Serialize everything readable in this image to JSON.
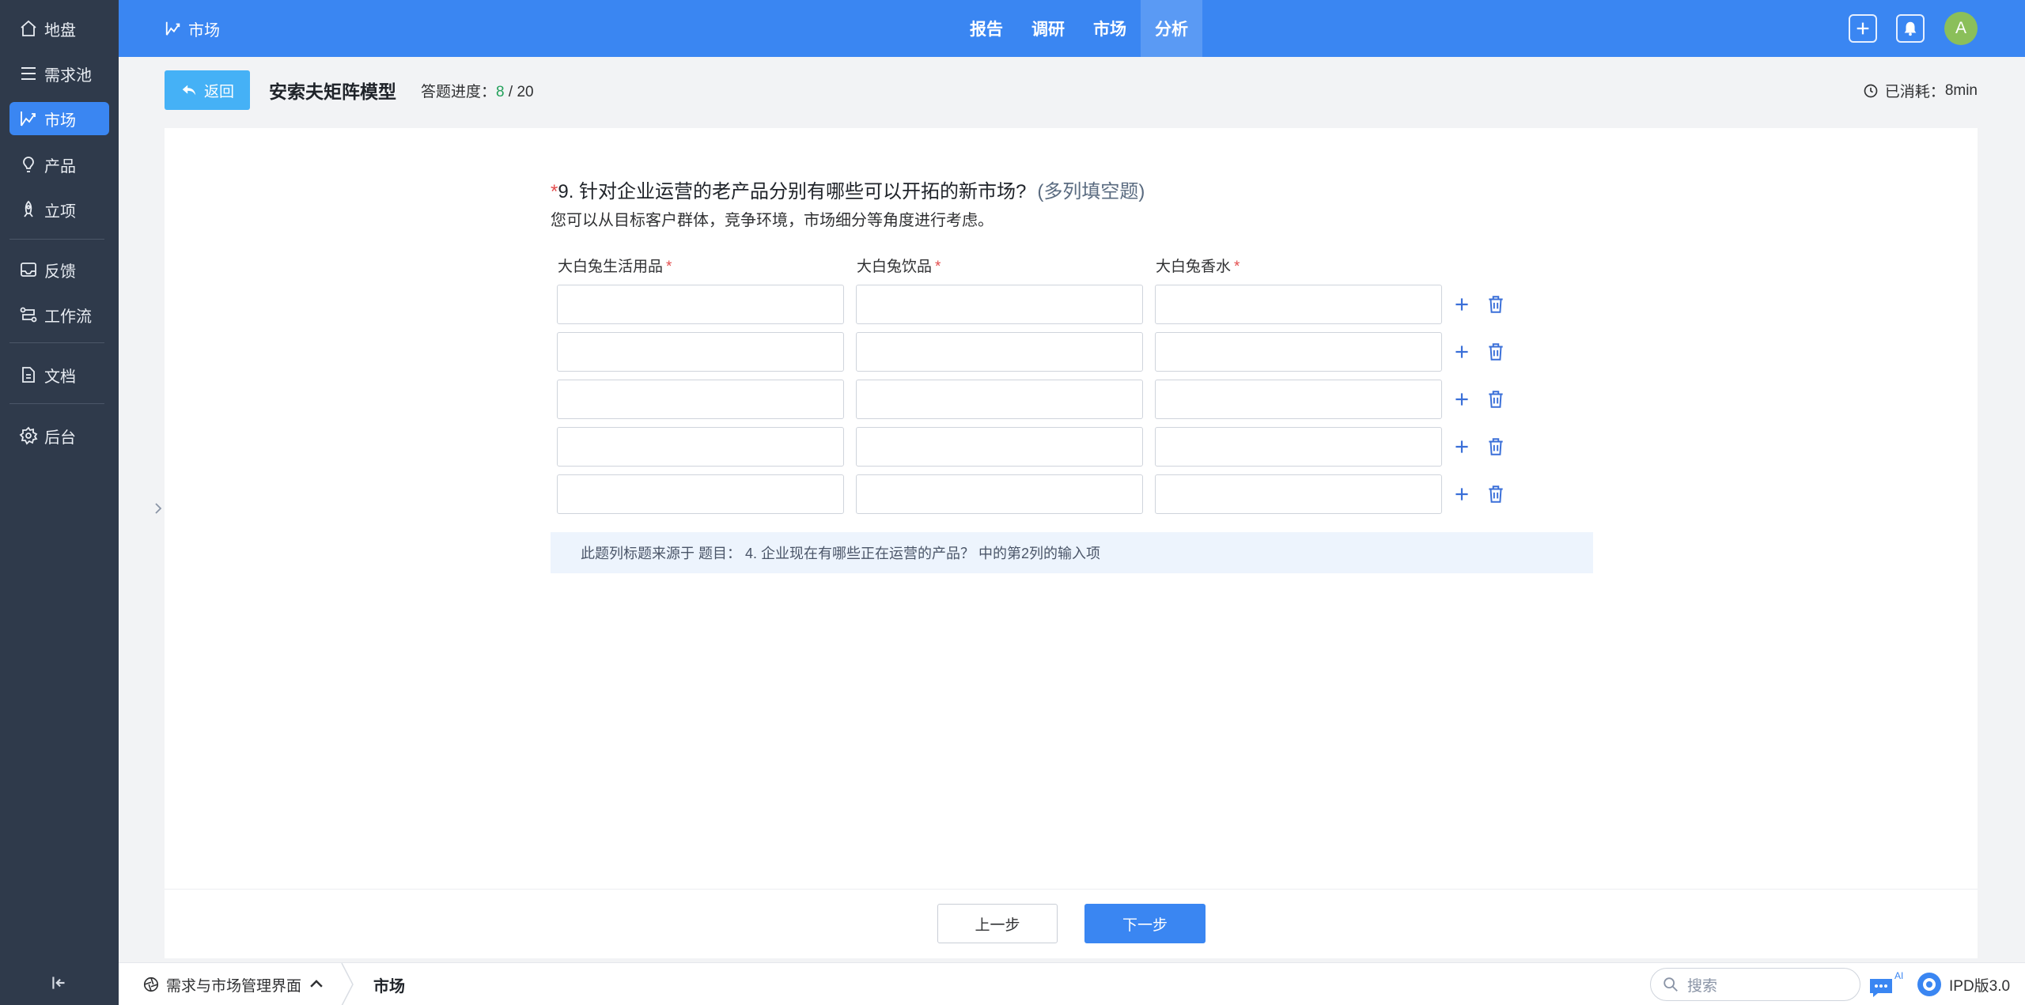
{
  "sidebar": {
    "items": [
      {
        "label": "地盘",
        "icon": "home-icon"
      },
      {
        "label": "需求池",
        "icon": "list-icon"
      },
      {
        "label": "市场",
        "icon": "chart-line-icon"
      },
      {
        "label": "产品",
        "icon": "lightbulb-icon"
      },
      {
        "label": "立项",
        "icon": "rocket-icon"
      },
      {
        "label": "反馈",
        "icon": "inbox-icon"
      },
      {
        "label": "工作流",
        "icon": "workflow-icon"
      },
      {
        "label": "文档",
        "icon": "document-icon"
      },
      {
        "label": "后台",
        "icon": "gear-icon"
      }
    ],
    "active": "市场"
  },
  "topbar": {
    "title": "市场",
    "nav": [
      "报告",
      "调研",
      "市场",
      "分析"
    ],
    "active_nav": "分析",
    "avatar_letter": "A",
    "accent": "#3a86f2"
  },
  "header": {
    "back_label": "返回",
    "title": "安索夫矩阵模型",
    "progress_label": "答题进度：",
    "progress_done": "8",
    "progress_sep": " / ",
    "progress_total": "20",
    "elapsed_label": "已消耗：",
    "elapsed_value": "8min"
  },
  "question": {
    "required_mark": "*",
    "title": "9. 针对企业运营的老产品分别有哪些可以开拓的新市场?",
    "type": "(多列填空题)",
    "description": "您可以从目标客户群体，竞争环境，市场细分等角度进行考虑。",
    "columns": [
      {
        "label": "大白兔生活用品",
        "required": "*"
      },
      {
        "label": "大白兔饮品",
        "required": "*"
      },
      {
        "label": "大白兔香水",
        "required": "*"
      }
    ],
    "rows": [
      [
        "",
        "",
        ""
      ],
      [
        "",
        "",
        ""
      ],
      [
        "",
        "",
        ""
      ],
      [
        "",
        "",
        ""
      ],
      [
        "",
        "",
        ""
      ]
    ],
    "source_note": "此题列标题来源于 题目： 4. 企业现在有哪些正在运营的产品？ 中的第2列的输入项"
  },
  "footer": {
    "prev_label": "上一步",
    "next_label": "下一步"
  },
  "bottombar": {
    "crumb_root": "需求与市场管理界面",
    "crumb_current": "市场",
    "search_placeholder": "搜索",
    "ai_badge": "AI",
    "version": "IPD版3.0"
  }
}
